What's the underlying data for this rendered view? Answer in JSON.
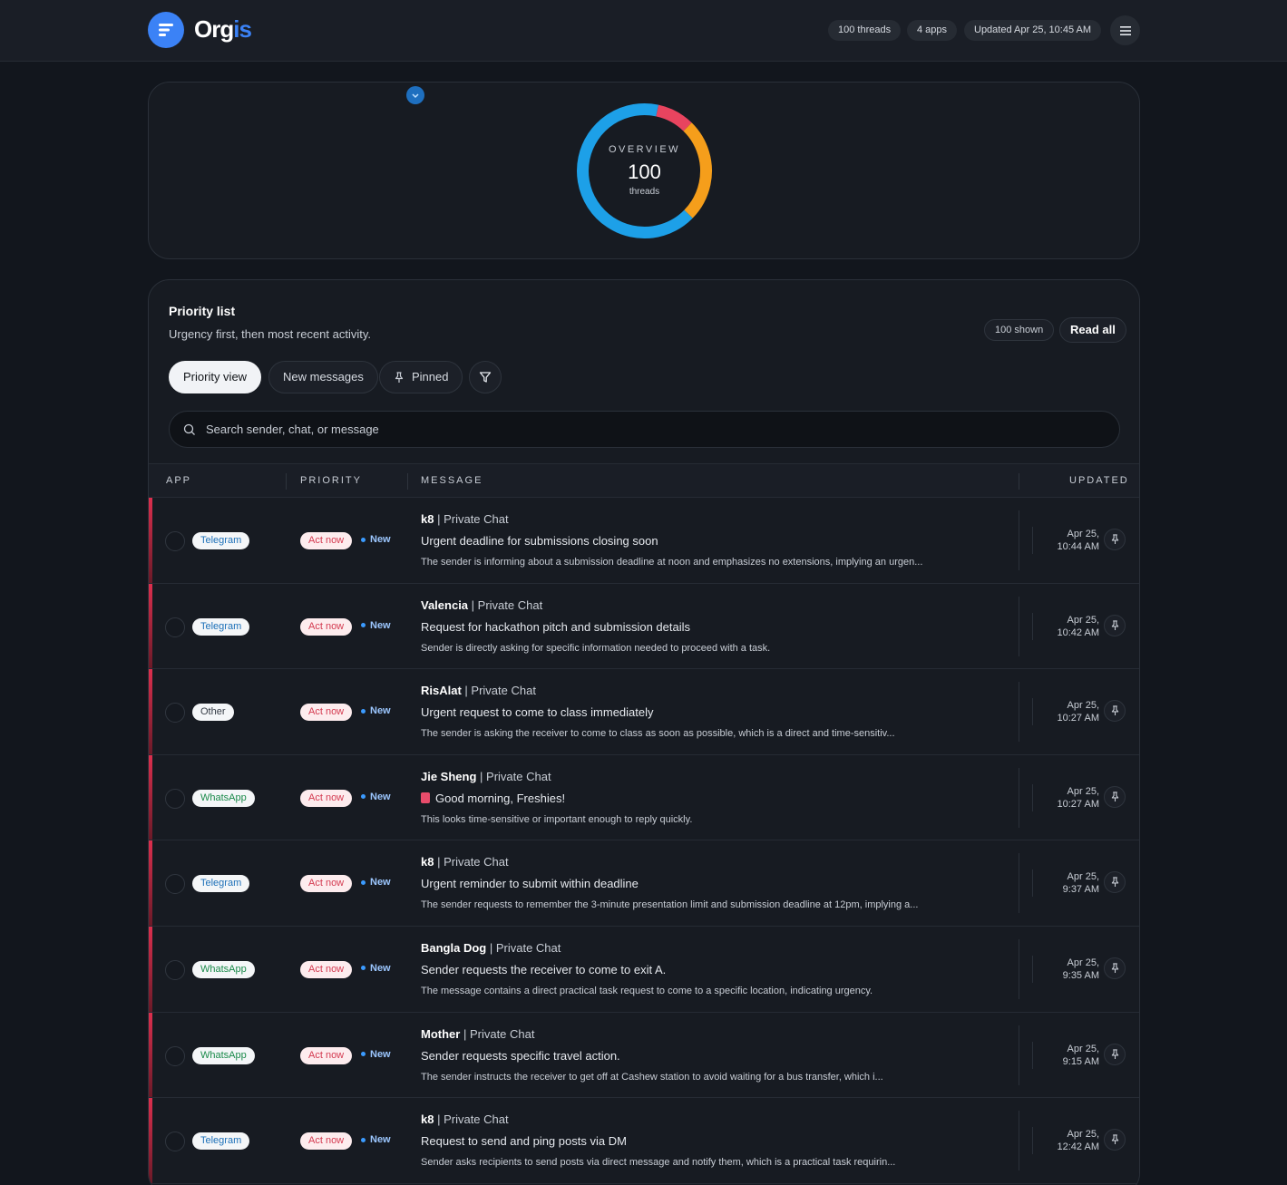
{
  "brand": {
    "name_a": "Org",
    "name_b": "is"
  },
  "header": {
    "threads_pill": "100 threads",
    "apps_pill": "4 apps",
    "updated_pill": "Updated Apr 25, 10:45 AM"
  },
  "overview": {
    "kicker": "OVERVIEW",
    "value": "100",
    "unit": "threads",
    "segments": [
      {
        "color": "#e8445f",
        "fraction": 0.09
      },
      {
        "color": "#f59e1b",
        "fraction": 0.25
      },
      {
        "color": "#1da0e8",
        "fraction": 0.66
      }
    ]
  },
  "priority": {
    "title": "Priority list",
    "subtitle": "Urgency first, then most recent activity.",
    "shown": "100 shown",
    "read_all": "Read all",
    "tabs": [
      "Priority view",
      "New messages",
      "Pinned"
    ],
    "search_placeholder": "Search sender, chat, or message",
    "columns": {
      "app": "APP",
      "priority": "PRIORITY",
      "message": "MESSAGE",
      "updated": "UPDATED"
    }
  },
  "rows": [
    {
      "app": "Telegram",
      "app_kind": "tg",
      "priority": "Act now",
      "tag": "New",
      "sender": "k8",
      "chat": " | Private Chat",
      "title": "Urgent deadline for submissions closing soon",
      "summary": "The sender is informing about a submission deadline at noon and emphasizes no extensions, implying an urgen...",
      "date": "Apr 25,",
      "time": "10:44 AM"
    },
    {
      "app": "Telegram",
      "app_kind": "tg",
      "priority": "Act now",
      "tag": "New",
      "sender": "Valencia",
      "chat": " | Private Chat",
      "title": "Request for hackathon pitch and submission details",
      "summary": "Sender is directly asking for specific information needed to proceed with a task.",
      "date": "Apr 25,",
      "time": "10:42 AM"
    },
    {
      "app": "Other",
      "app_kind": "ot",
      "priority": "Act now",
      "tag": "New",
      "sender": "RisAlat",
      "chat": " | Private Chat",
      "title": "Urgent request to come to class immediately",
      "summary": "The sender is asking the receiver to come to class as soon as possible, which is a direct and time-sensitiv...",
      "date": "Apr 25,",
      "time": "10:27 AM"
    },
    {
      "app": "WhatsApp",
      "app_kind": "wa",
      "priority": "Act now",
      "tag": "New",
      "sender": "Jie Sheng",
      "chat": " | Private Chat",
      "title": "Good morning, Freshies!",
      "emoji": true,
      "summary": "This looks time-sensitive or important enough to reply quickly.",
      "date": "Apr 25,",
      "time": "10:27 AM"
    },
    {
      "app": "Telegram",
      "app_kind": "tg",
      "priority": "Act now",
      "tag": "New",
      "sender": "k8",
      "chat": " | Private Chat",
      "title": "Urgent reminder to submit within deadline",
      "summary": "The sender requests to remember the 3-minute presentation limit and submission deadline at 12pm, implying a...",
      "date": "Apr 25,",
      "time": "9:37 AM"
    },
    {
      "app": "WhatsApp",
      "app_kind": "wa",
      "priority": "Act now",
      "tag": "New",
      "sender": "Bangla Dog",
      "chat": " | Private Chat",
      "title": "Sender requests the receiver to come to exit A.",
      "summary": "The message contains a direct practical task request to come to a specific location, indicating urgency.",
      "date": "Apr 25,",
      "time": "9:35 AM"
    },
    {
      "app": "WhatsApp",
      "app_kind": "wa",
      "priority": "Act now",
      "tag": "New",
      "sender": "Mother",
      "chat": " | Private Chat",
      "title": "Sender requests specific travel action.",
      "summary": "The sender instructs the receiver to get off at Cashew station to avoid waiting for a bus transfer, which i...",
      "date": "Apr 25,",
      "time": "9:15 AM"
    },
    {
      "app": "Telegram",
      "app_kind": "tg",
      "priority": "Act now",
      "tag": "New",
      "sender": "k8",
      "chat": " | Private Chat",
      "title": "Request to send and ping posts via DM",
      "summary": "Sender asks recipients to send posts via direct message and notify them, which is a practical task requirin...",
      "date": "Apr 25,",
      "time": "12:42 AM"
    }
  ]
}
